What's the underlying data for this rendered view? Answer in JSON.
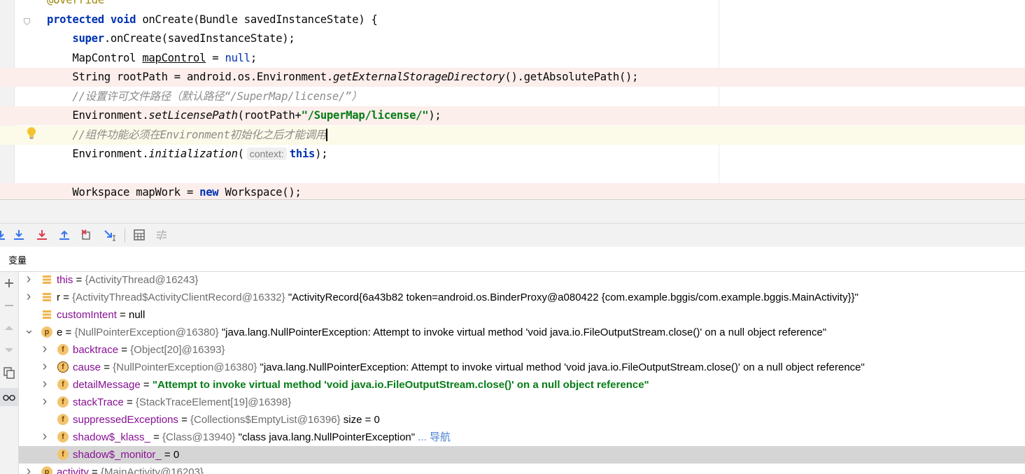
{
  "editor": {
    "lines": [
      {
        "id": "l0",
        "parts": [
          {
            "t": "@Override",
            "c": "ann"
          }
        ]
      },
      {
        "id": "l1",
        "parts": [
          {
            "t": "protected",
            "c": "kw"
          },
          {
            "t": " "
          },
          {
            "t": "void",
            "c": "kw"
          },
          {
            "t": " onCreate(Bundle savedInstanceState) {"
          }
        ]
      },
      {
        "id": "l2",
        "parts": [
          {
            "t": "    "
          },
          {
            "t": "super",
            "c": "kw"
          },
          {
            "t": ".onCreate(savedInstanceState);"
          }
        ]
      },
      {
        "id": "l3",
        "parts": [
          {
            "t": "    MapControl "
          },
          {
            "t": "mapControl",
            "c": "under"
          },
          {
            "t": " = "
          },
          {
            "t": "null",
            "c": "null"
          },
          {
            "t": ";"
          }
        ]
      },
      {
        "id": "l4",
        "parts": [
          {
            "t": "    String rootPath = android.os.Environment."
          },
          {
            "t": "getExternalStorageDirectory",
            "c": "it"
          },
          {
            "t": "().getAbsolutePath();"
          }
        ]
      },
      {
        "id": "l5",
        "parts": [
          {
            "t": "    //设置许可文件路径（默认路径“/SuperMap/license/”）",
            "c": "cmt"
          }
        ]
      },
      {
        "id": "l6",
        "parts": [
          {
            "t": "    Environment."
          },
          {
            "t": "setLicensePath",
            "c": "it"
          },
          {
            "t": "(rootPath+"
          },
          {
            "t": "\"/SuperMap/license/\"",
            "c": "str"
          },
          {
            "t": ");"
          }
        ]
      },
      {
        "id": "l7",
        "parts": [
          {
            "t": "    //组件功能必须在Environment初始化之后才能调用",
            "c": "cmt"
          },
          {
            "t": "",
            "c": "caret"
          }
        ]
      },
      {
        "id": "l8",
        "parts": [
          {
            "t": "    Environment."
          },
          {
            "t": "initialization",
            "c": "it"
          },
          {
            "t": "("
          },
          {
            "t": "context:",
            "c": "hint"
          },
          {
            "t": "this",
            "c": "kw"
          },
          {
            "t": ");"
          }
        ]
      },
      {
        "id": "l9",
        "parts": [
          {
            "t": ""
          }
        ]
      },
      {
        "id": "l10",
        "parts": [
          {
            "t": "    Workspace mapWork = "
          },
          {
            "t": "new",
            "c": "kw"
          },
          {
            "t": " Workspace();"
          }
        ]
      }
    ]
  },
  "debug": {
    "toolbar_icons": [
      "step-over-icon",
      "step-into-icon",
      "force-step-into-icon",
      "step-out-icon",
      "drop-frame-icon",
      "run-to-cursor-icon",
      "evaluate-expression-icon",
      "trace-current-stream-icon"
    ],
    "variables_tab_label": "变量",
    "side_icons": [
      "add-watch-icon",
      "remove-watch-icon",
      "move-up-icon",
      "move-down-icon",
      "copy-icon",
      "show-watches-icon"
    ],
    "variables": [
      {
        "arrow": "right",
        "icon": "list",
        "icon_letter": "",
        "name": "this",
        "name_style": "field",
        "eq": " = ",
        "type": "{ActivityThread@16243}",
        "value": "",
        "value_style": "",
        "link": ""
      },
      {
        "arrow": "right",
        "icon": "list",
        "icon_letter": "",
        "name": "r",
        "name_style": "plain",
        "eq": " = ",
        "type": "{ActivityThread$ActivityClientRecord@16332}",
        "value": "\"ActivityRecord{6a43b82 token=android.os.BinderProxy@a080422 {com.example.bggis/com.example.bggis.MainActivity}}\"",
        "value_style": "plain",
        "link": ""
      },
      {
        "arrow": "",
        "icon": "list",
        "icon_letter": "",
        "name": "customIntent",
        "name_style": "field",
        "eq": " = null",
        "type": "",
        "value": "",
        "value_style": "",
        "link": ""
      },
      {
        "arrow": "down",
        "icon": "circle",
        "icon_letter": "p",
        "name": "e",
        "name_style": "plain",
        "eq": " = ",
        "type": "{NullPointerException@16380}",
        "value": "\"java.lang.NullPointerException: Attempt to invoke virtual method 'void java.io.FileOutputStream.close()' on a null object reference\"",
        "value_style": "plain",
        "link": ""
      },
      {
        "arrow": "right",
        "icon": "circle",
        "icon_letter": "f",
        "name": "backtrace",
        "name_style": "field",
        "eq": " = ",
        "type": "{Object[20]@16393}",
        "value": "",
        "value_style": "",
        "link": "",
        "indent": 1
      },
      {
        "arrow": "right",
        "icon": "circle-final",
        "icon_letter": "f",
        "name": "cause",
        "name_style": "field",
        "eq": " = ",
        "type": "{NullPointerException@16380}",
        "value": "\"java.lang.NullPointerException: Attempt to invoke virtual method 'void java.io.FileOutputStream.close()' on a null object reference\"",
        "value_style": "plain",
        "link": "",
        "indent": 1
      },
      {
        "arrow": "right",
        "icon": "circle",
        "icon_letter": "f",
        "name": "detailMessage",
        "name_style": "field",
        "eq": " = ",
        "type": "",
        "value": "\"Attempt to invoke virtual method 'void java.io.FileOutputStream.close()' on a null object reference\"",
        "value_style": "green",
        "link": "",
        "indent": 1
      },
      {
        "arrow": "right",
        "icon": "circle",
        "icon_letter": "f",
        "name": "stackTrace",
        "name_style": "field",
        "eq": " = ",
        "type": "{StackTraceElement[19]@16398}",
        "value": "",
        "value_style": "",
        "link": "",
        "indent": 1
      },
      {
        "arrow": "",
        "icon": "circle",
        "icon_letter": "f",
        "name": "suppressedExceptions",
        "name_style": "field",
        "eq": " = ",
        "type": "{Collections$EmptyList@16396}",
        "value": " size = 0",
        "value_style": "plain",
        "link": "",
        "indent": 1
      },
      {
        "arrow": "right",
        "icon": "circle",
        "icon_letter": "f",
        "name": "shadow$_klass_",
        "name_style": "field",
        "eq": " = ",
        "type": "{Class@13940}",
        "value": "\"class java.lang.NullPointerException\"",
        "value_style": "plain",
        "link": "... 导航",
        "indent": 1
      },
      {
        "arrow": "",
        "icon": "circle",
        "icon_letter": "f",
        "name": "shadow$_monitor_",
        "name_style": "field",
        "eq": " = 0",
        "type": "",
        "value": "",
        "value_style": "",
        "link": "",
        "indent": 1,
        "selected": true
      },
      {
        "arrow": "right",
        "icon": "circle",
        "icon_letter": "p",
        "name": "activity",
        "name_style": "field",
        "eq": " = ",
        "type": "{MainActivity@16203}",
        "value": "",
        "value_style": "",
        "link": ""
      }
    ]
  }
}
